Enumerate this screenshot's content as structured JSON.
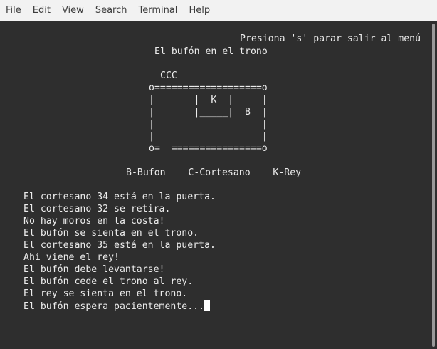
{
  "menubar": {
    "items": [
      "File",
      "Edit",
      "View",
      "Search",
      "Terminal",
      "Help"
    ]
  },
  "terminal": {
    "header_hint": "Presiona 's' parar salir al menú",
    "title": "El bufón en el trono",
    "queue": "CCC",
    "diagram": [
      "o===================o",
      "|       |  K  |     |",
      "|       |_____|  B  |",
      "|                   |",
      "|                   |",
      "o=  ================o"
    ],
    "legend": "B-Bufon    C-Cortesano    K-Rey",
    "log": [
      "El cortesano 34 está en la puerta.",
      "El cortesano 32 se retira.",
      "No hay moros en la costa!",
      "El bufón se sienta en el trono.",
      "El cortesano 35 está en la puerta.",
      "Ahi viene el rey!",
      "El bufón debe levantarse!",
      "El bufón cede el trono al rey.",
      "El rey se sienta en el trono.",
      "El bufón espera pacientemente..."
    ]
  }
}
